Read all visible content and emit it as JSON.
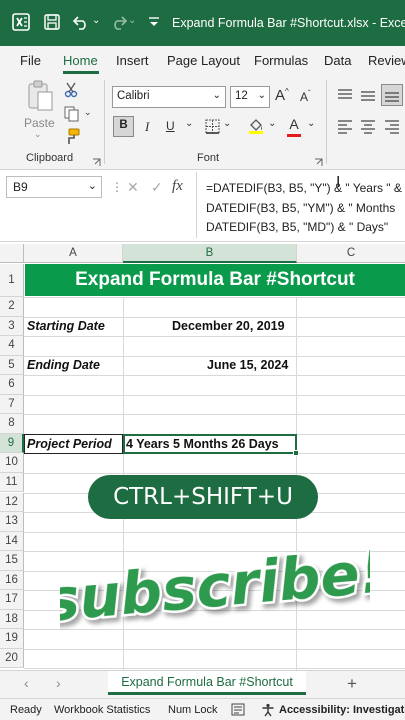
{
  "titlebar": {
    "title": "Expand Formula Bar #Shortcut.xlsx  -  Excel",
    "icons": [
      "excel-logo-icon",
      "save-icon",
      "undo-icon",
      "redo-icon",
      "customize-toolbar-icon"
    ]
  },
  "menu": {
    "items": [
      "File",
      "Home",
      "Insert",
      "Page Layout",
      "Formulas",
      "Data",
      "Review"
    ],
    "active": "Home"
  },
  "ribbon": {
    "paste_label": "Paste",
    "clipboard_label": "Clipboard",
    "font_name": "Calibri",
    "font_size": "12",
    "grow_font": "A",
    "shrink_font": "A",
    "bold": "B",
    "italic": "I",
    "underline": "U",
    "font_color_letter": "A",
    "font_label": "Font"
  },
  "formula_bar": {
    "name_box": "B9",
    "cancel": "✕",
    "enter": "✓",
    "fx": "fx",
    "lines": [
      "=DATEDIF(B3, B5, \"Y\") & \" Years \" &",
      "DATEDIF(B3, B5, \"YM\") & \" Months",
      "DATEDIF(B3, B5, \"MD\") & \" Days\""
    ]
  },
  "grid": {
    "columns": [
      "A",
      "B",
      "C"
    ],
    "rows": [
      "1",
      "2",
      "3",
      "4",
      "5",
      "6",
      "7",
      "8",
      "9",
      "10",
      "11",
      "12",
      "13",
      "14",
      "15",
      "16",
      "17",
      "18",
      "19",
      "20"
    ],
    "banner": "Expand Formula Bar #Shortcut",
    "starting_label": "Starting Date",
    "starting_value": "December 20, 2019",
    "ending_label": "Ending Date",
    "ending_value": "June 15, 2024",
    "period_label": "Project Period",
    "period_value": "4 Years 5 Months 26 Days"
  },
  "overlay": {
    "shortcut": "CTRL+SHIFT+U",
    "subscribe": "subscribe!"
  },
  "sheets": {
    "tab": "Expand Formula Bar #Shortcut",
    "add": "+"
  },
  "status": {
    "ready": "Ready",
    "workbook_stats": "Workbook Statistics",
    "num_lock": "Num Lock",
    "accessibility": "Accessibility: Investigate"
  },
  "colors": {
    "excel_green": "#1e6c41",
    "banner_green": "#0a9a4c",
    "subscribe_green": "#2e9a4e"
  }
}
